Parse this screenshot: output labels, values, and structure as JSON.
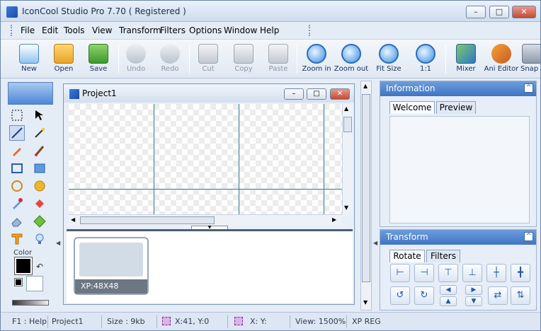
{
  "window": {
    "title": "IconCool Studio Pro 7.70 ( Registered )",
    "buttons": {
      "minimize": "–",
      "maximize": "□",
      "close": "✕"
    }
  },
  "menu": [
    "File",
    "Edit",
    "Tools",
    "View",
    "Transform",
    "Filters",
    "Options",
    "Window",
    "Help"
  ],
  "toolbar": {
    "new": "New",
    "open": "Open",
    "save": "Save",
    "undo": "Undo",
    "redo": "Redo",
    "cut": "Cut",
    "copy": "Copy",
    "paste": "Paste",
    "zoom_in": "Zoom in",
    "zoom_out": "Zoom out",
    "fit_size": "Fit Size",
    "one_to_one": "1:1",
    "mixer": "Mixer",
    "ani_editor": "Ani Editor",
    "snap": "Snap"
  },
  "left_panel": {
    "color_label": "Color"
  },
  "document": {
    "title": "Project1",
    "thumbnail_caption": "XP:48X48"
  },
  "information": {
    "header": "Information",
    "tabs": [
      "Welcome",
      "Preview"
    ],
    "collapse": "^"
  },
  "transform": {
    "header": "Transform",
    "tabs": [
      "Rotate",
      "Filters"
    ],
    "collapse": "^"
  },
  "status": {
    "help": "F1 : Help",
    "project": "Project1",
    "size": "Size : 9kb",
    "cursor": "X:41, Y:0",
    "selection": "X: Y:",
    "view": "View: 1500%",
    "format": "XP REG"
  }
}
